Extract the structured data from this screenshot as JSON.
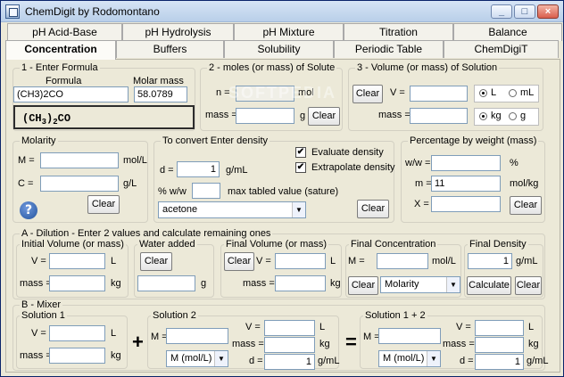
{
  "window": {
    "title": "ChemDigit by Rodomontano",
    "buttons": {
      "minimize": "_",
      "maximize": "□",
      "close": "×"
    }
  },
  "tabs": {
    "row1": [
      "pH Acid-Base",
      "pH Hydrolysis",
      "pH Mixture",
      "Titration",
      "Balance"
    ],
    "row2": [
      "Concentration",
      "Buffers",
      "Solubility",
      "Periodic Table",
      "ChemDigiT"
    ],
    "active": "Concentration"
  },
  "formula": {
    "legend": "1 - Enter Formula",
    "formula_label": "Formula",
    "molar_mass_label": "Molar mass",
    "formula_value": "(CH3)2CO",
    "molar_mass_value": "58.0789",
    "display": {
      "a": "(CH",
      "b": "3",
      "c": ")",
      "d": "2",
      "e": "CO"
    }
  },
  "moles": {
    "legend": "2 - moles (or mass) of Solute",
    "n_label": "n =",
    "n_unit": "mol",
    "mass_label": "mass =",
    "mass_unit": "g",
    "clear": "Clear",
    "n_value": "",
    "mass_value": ""
  },
  "volume": {
    "legend": "3 - Volume (or mass) of Solution",
    "clear": "Clear",
    "v_label": "V =",
    "mass_label": "mass =",
    "v_value": "",
    "mass_value": "",
    "unit_options": [
      "L",
      "mL"
    ],
    "unit_selected": "L",
    "mass_options": [
      "kg",
      "g"
    ],
    "mass_selected": "kg"
  },
  "molarity": {
    "legend": "Molarity",
    "m_label": "M =",
    "m_unit": "mol/L",
    "c_label": "C =",
    "c_unit": "g/L",
    "clear": "Clear",
    "m_value": "",
    "c_value": "",
    "help_icon": "?"
  },
  "density": {
    "legend": "To convert Enter density",
    "evaluate_label": "Evaluate density",
    "extrapolate_label": "Extrapolate density",
    "d_label": "d =",
    "d_value": "1",
    "d_unit": "g/mL",
    "ww_label": "% w/w",
    "ww_value": "",
    "max_label": "max tabled value (sature)",
    "select_value": "acetone",
    "clear": "Clear",
    "check_mark": "✔"
  },
  "percentage": {
    "legend": "Percentage by weight (mass)",
    "ww_label": "w/w =",
    "ww_unit": "%",
    "m_label": "m =",
    "m_value": "11",
    "m_unit": "mol/kg",
    "x_label": "X =",
    "clear": "Clear",
    "ww_value": "",
    "x_value": ""
  },
  "dilution": {
    "legend": "A - Dilution - Enter 2 values and calculate remaining ones",
    "initial_legend": "Initial Volume (or mass)",
    "v_label": "V =",
    "v_unit": "L",
    "mass_label": "mass =",
    "mass_unit": "kg",
    "water_legend": "Water added",
    "water_clear": "Clear",
    "water_unit": "g",
    "final_volume_legend": "Final Volume (or mass)",
    "final_clear": "Clear",
    "final_conc_legend": "Final Concentration",
    "m_label": "M =",
    "m_unit": "mol/L",
    "conc_clear": "Clear",
    "conc_select": "Molarity",
    "final_density_legend": "Final Density",
    "density_value": "1",
    "density_unit": "g/mL",
    "calculate": "Calculate",
    "density_clear": "Clear"
  },
  "mixer": {
    "legend": "B - Mixer",
    "solution1_legend": "Solution 1",
    "solution2_legend": "Solution 2",
    "solution12_legend": "Solution 1 + 2",
    "plus": "+",
    "equals": "=",
    "v_label": "V =",
    "v_unit": "L",
    "mass_label": "mass =",
    "mass_unit": "kg",
    "m_label": "M =",
    "d_label": "d =",
    "d_value": "1",
    "d_unit": "g/mL",
    "select_value": "M (mol/L)"
  },
  "watermark": "SOFTPEDIA"
}
